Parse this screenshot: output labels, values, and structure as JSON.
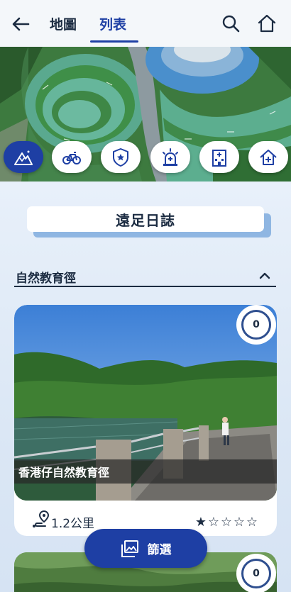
{
  "header": {
    "tabs": [
      {
        "label": "地圖",
        "active": false
      },
      {
        "label": "列表",
        "active": true
      }
    ],
    "icons": {
      "back": "arrow-left-icon",
      "search": "search-icon",
      "home": "home-icon"
    }
  },
  "categories": [
    {
      "icon": "mountain-hiking-icon",
      "active": true
    },
    {
      "icon": "bicycle-icon",
      "active": false
    },
    {
      "icon": "police-badge-icon",
      "active": false
    },
    {
      "icon": "siren-icon",
      "active": false
    },
    {
      "icon": "hospital-icon",
      "active": false
    },
    {
      "icon": "shelter-house-icon",
      "active": false
    }
  ],
  "page_title": "遠足日誌",
  "section": {
    "label": "自然教育徑",
    "expanded": true
  },
  "cards": [
    {
      "name": "香港仔自然教育徑",
      "count": "0",
      "distance": "1.2公里",
      "rating": 1,
      "max_rating": 5
    },
    {
      "count": "0"
    }
  ],
  "filter": {
    "label": "篩選",
    "icon": "image-gallery-icon"
  },
  "colors": {
    "primary": "#1e3fa4",
    "text": "#1c2c42",
    "background": "#dfe9f6"
  }
}
